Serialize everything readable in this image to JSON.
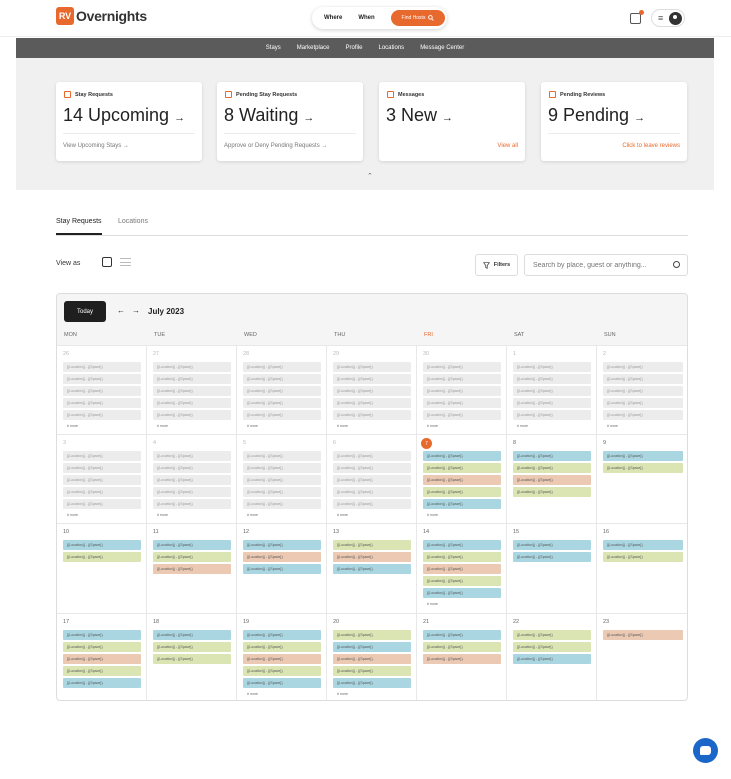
{
  "header": {
    "logo_badge": "RV",
    "logo_text": "Overnights",
    "search": {
      "where_label": "Where",
      "when_label": "When",
      "find_button": "Find Hosts"
    }
  },
  "nav": [
    "Stays",
    "Marketplace",
    "Profile",
    "Locations",
    "Message Center"
  ],
  "stats": [
    {
      "label": "Stay Requests",
      "value": "14 Upcoming",
      "link": "View Upcoming Stays"
    },
    {
      "label": "Pending Stay Requests",
      "value": "8 Waiting",
      "link": "Approve or Deny Pending Requests"
    },
    {
      "label": "Messages",
      "value": "3 New",
      "link": "View all"
    },
    {
      "label": "Pending Reviews",
      "value": "9 Pending",
      "link": "Click to leave reviews"
    }
  ],
  "tabs": [
    "Stay Requests",
    "Locations"
  ],
  "view_as_label": "View as",
  "filters_label": "Filters",
  "search_placeholder": "Search by place, guest or anything...",
  "calendar": {
    "today_label": "Today",
    "month": "July 2023",
    "days_of_week": [
      "MON",
      "TUE",
      "WED",
      "THU",
      "FRI",
      "SAT",
      "SUN"
    ],
    "event_text": "{{Location}} - {{Space}}",
    "more_label": "# more",
    "weeks": [
      [
        {
          "num": "26",
          "muted": true,
          "events": [
            "grey",
            "grey",
            "grey",
            "grey",
            "grey"
          ],
          "more": true
        },
        {
          "num": "27",
          "muted": true,
          "events": [
            "grey",
            "grey",
            "grey",
            "grey",
            "grey"
          ],
          "more": true
        },
        {
          "num": "28",
          "muted": true,
          "events": [
            "grey",
            "grey",
            "grey",
            "grey",
            "grey"
          ],
          "more": true
        },
        {
          "num": "29",
          "muted": true,
          "events": [
            "grey",
            "grey",
            "grey",
            "grey",
            "grey"
          ],
          "more": true
        },
        {
          "num": "30",
          "muted": true,
          "events": [
            "grey",
            "grey",
            "grey",
            "grey",
            "grey"
          ],
          "more": true
        },
        {
          "num": "1",
          "muted": true,
          "events": [
            "grey",
            "grey",
            "grey",
            "grey",
            "grey"
          ],
          "more": true
        },
        {
          "num": "2",
          "muted": true,
          "events": [
            "grey",
            "grey",
            "grey",
            "grey",
            "grey"
          ],
          "more": true
        }
      ],
      [
        {
          "num": "3",
          "muted": true,
          "events": [
            "grey",
            "grey",
            "grey",
            "grey",
            "grey"
          ],
          "more": true
        },
        {
          "num": "4",
          "muted": true,
          "events": [
            "grey",
            "grey",
            "grey",
            "grey",
            "grey"
          ],
          "more": true
        },
        {
          "num": "5",
          "muted": true,
          "events": [
            "grey",
            "grey",
            "grey",
            "grey",
            "grey"
          ],
          "more": true
        },
        {
          "num": "6",
          "muted": true,
          "events": [
            "grey",
            "grey",
            "grey",
            "grey",
            "grey"
          ],
          "more": true
        },
        {
          "num": "7",
          "today": true,
          "events": [
            "blue",
            "green",
            "peach",
            "green",
            "blue"
          ],
          "more": true
        },
        {
          "num": "8",
          "events": [
            "blue",
            "green",
            "peach",
            "green"
          ],
          "more": false
        },
        {
          "num": "9",
          "events": [
            "blue",
            "green"
          ],
          "more": false
        }
      ],
      [
        {
          "num": "10",
          "events": [
            "blue",
            "green"
          ],
          "more": false
        },
        {
          "num": "11",
          "events": [
            "blue",
            "green",
            "peach"
          ],
          "more": false
        },
        {
          "num": "12",
          "events": [
            "blue",
            "peach",
            "blue"
          ],
          "more": false
        },
        {
          "num": "13",
          "events": [
            "green",
            "peach",
            "blue"
          ],
          "more": false
        },
        {
          "num": "14",
          "events": [
            "blue",
            "green",
            "peach",
            "green",
            "blue"
          ],
          "more": true
        },
        {
          "num": "15",
          "events": [
            "blue",
            "blue"
          ],
          "more": false
        },
        {
          "num": "16",
          "events": [
            "blue",
            "green"
          ],
          "more": false
        }
      ],
      [
        {
          "num": "17",
          "events": [
            "blue",
            "green",
            "peach",
            "green",
            "blue"
          ],
          "more": false
        },
        {
          "num": "18",
          "events": [
            "blue",
            "green",
            "green"
          ],
          "more": false
        },
        {
          "num": "19",
          "events": [
            "blue",
            "green",
            "peach",
            "green",
            "blue"
          ],
          "more": true
        },
        {
          "num": "20",
          "events": [
            "green",
            "blue",
            "peach",
            "green",
            "blue"
          ],
          "more": true
        },
        {
          "num": "21",
          "events": [
            "blue",
            "green",
            "peach"
          ],
          "more": false
        },
        {
          "num": "22",
          "events": [
            "green",
            "green",
            "blue"
          ],
          "more": false
        },
        {
          "num": "23",
          "events": [
            "peach"
          ],
          "more": false
        }
      ]
    ]
  },
  "colors": {
    "accent": "#e8692d",
    "nav_bg": "#5b5b5b",
    "event_blue": "#a9d6e1",
    "event_green": "#dbe4b3",
    "event_peach": "#ebc9b3",
    "chat": "#1b66c9"
  }
}
